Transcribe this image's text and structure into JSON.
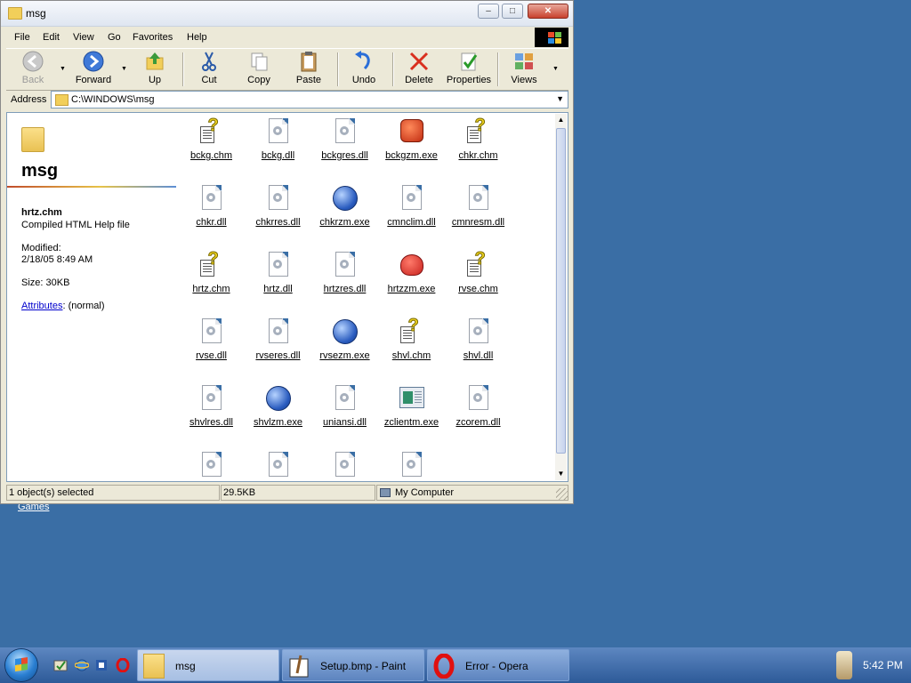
{
  "desktop": {
    "link_text": "Games"
  },
  "window": {
    "title": "msg",
    "controls": {
      "minimize": "–",
      "maximize": "□",
      "close": "✕"
    }
  },
  "menu": [
    "File",
    "Edit",
    "View",
    "Go",
    "Favorites",
    "Help"
  ],
  "toolbar": {
    "back": "Back",
    "forward": "Forward",
    "up": "Up",
    "cut": "Cut",
    "copy": "Copy",
    "paste": "Paste",
    "undo": "Undo",
    "delete": "Delete",
    "properties": "Properties",
    "views": "Views"
  },
  "address": {
    "label": "Address",
    "path": "C:\\WINDOWS\\msg"
  },
  "info_pane": {
    "folder_name": "msg",
    "selected_name": "hrtz.chm",
    "selected_type": "Compiled HTML Help file",
    "modified_label": "Modified:",
    "modified_value": "2/18/05 8:49 AM",
    "size": "Size: 30KB",
    "attributes_link": "Attributes",
    "attributes_value": ": (normal)"
  },
  "files": [
    {
      "name": "bckg.chm",
      "icon": "chm"
    },
    {
      "name": "bckg.dll",
      "icon": "dll"
    },
    {
      "name": "bckgres.dll",
      "icon": "dll"
    },
    {
      "name": "bckgzm.exe",
      "icon": "exe-red"
    },
    {
      "name": "chkr.chm",
      "icon": "chm"
    },
    {
      "name": "chkr.dll",
      "icon": "dll"
    },
    {
      "name": "chkrres.dll",
      "icon": "dll"
    },
    {
      "name": "chkrzm.exe",
      "icon": "exe-blue"
    },
    {
      "name": "cmnclim.dll",
      "icon": "dll"
    },
    {
      "name": "cmnresm.dll",
      "icon": "dll"
    },
    {
      "name": "hrtz.chm",
      "icon": "chm"
    },
    {
      "name": "hrtz.dll",
      "icon": "dll"
    },
    {
      "name": "hrtzres.dll",
      "icon": "dll"
    },
    {
      "name": "hrtzzm.exe",
      "icon": "exe-heart"
    },
    {
      "name": "rvse.chm",
      "icon": "chm"
    },
    {
      "name": "rvse.dll",
      "icon": "dll"
    },
    {
      "name": "rvseres.dll",
      "icon": "dll"
    },
    {
      "name": "rvsezm.exe",
      "icon": "exe-blue"
    },
    {
      "name": "shvl.chm",
      "icon": "chm"
    },
    {
      "name": "shvl.dll",
      "icon": "dll"
    },
    {
      "name": "shvlres.dll",
      "icon": "dll"
    },
    {
      "name": "shvlzm.exe",
      "icon": "exe-blue"
    },
    {
      "name": "uniansi.dll",
      "icon": "dll"
    },
    {
      "name": "zclientm.exe",
      "icon": "exe-win"
    },
    {
      "name": "zcorem.dll",
      "icon": "dll"
    },
    {
      "name": "",
      "icon": "dll"
    },
    {
      "name": "",
      "icon": "dll"
    },
    {
      "name": "",
      "icon": "dll"
    },
    {
      "name": "",
      "icon": "dll"
    }
  ],
  "status": {
    "selection": "1 object(s) selected",
    "size": "29.5KB",
    "zone": "My Computer"
  },
  "taskbar": {
    "tasks": [
      {
        "label": "msg"
      },
      {
        "label": "Setup.bmp - Paint"
      },
      {
        "label": "Error - Opera"
      }
    ],
    "clock": "5:42 PM"
  }
}
